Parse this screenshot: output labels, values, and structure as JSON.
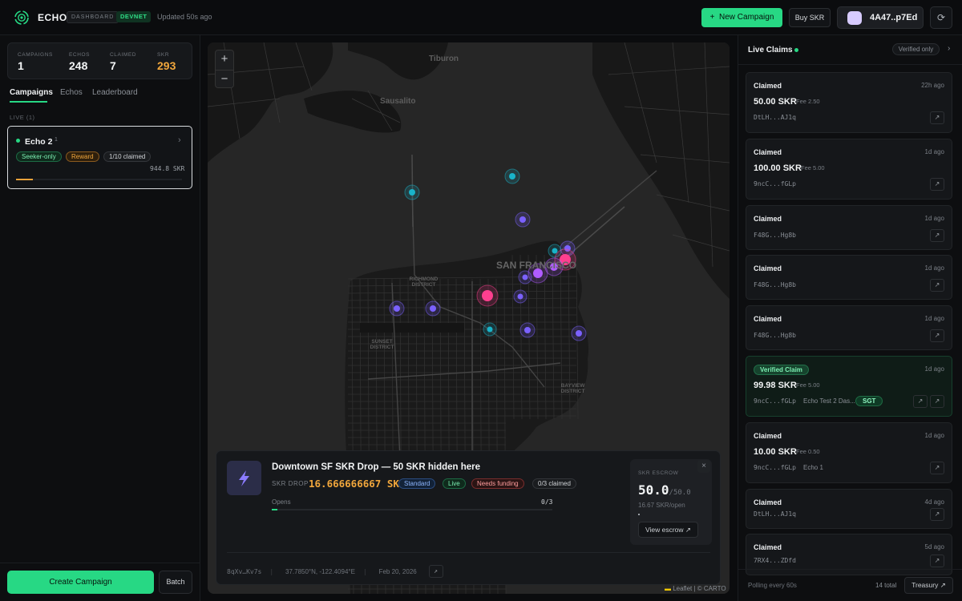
{
  "header": {
    "brand": "ECHO",
    "brand_sub": "DASHBOARD",
    "network": "DEVNET",
    "updated": "Updated 50s ago",
    "new_campaign": "New Campaign",
    "buy_skr": "Buy SKR",
    "wallet": "4A47..p7Ed",
    "accent": "#27d884"
  },
  "stats": [
    {
      "label": "CAMPAIGNS",
      "value": "1"
    },
    {
      "label": "ECHOS",
      "value": "248"
    },
    {
      "label": "CLAIMED",
      "value": "7"
    },
    {
      "label": "SKR",
      "value": "293",
      "color": "#f0a63c"
    }
  ],
  "tabs": [
    "Campaigns",
    "Echos",
    "Leaderboard"
  ],
  "live_header": "LIVE (1)",
  "campaign": {
    "name": "Echo 2",
    "index": "1",
    "tags": [
      "Seeker-only",
      "Reward",
      "1/10 claimed"
    ],
    "amount": "944.8 SKR",
    "progress": 0.1
  },
  "footer": {
    "create": "Create Campaign",
    "batch": "Batch"
  },
  "map": {
    "labels": [
      "Tiburon",
      "Sausalito",
      "SAN FRANCISCO",
      "RICHMOND DISTRICT",
      "SUNSET DISTRICT",
      "BAYVIEW DISTRICT"
    ],
    "attribution": "Leaflet | © CARTO",
    "zoom_in": "+",
    "zoom_out": "−"
  },
  "popup": {
    "title": "Downtown SF SKR Drop — 50 SKR hidden here",
    "kind": "SKR DROP",
    "amount": "16.666666667 SKR",
    "tags": [
      "Standard",
      "Live",
      "Needs funding",
      "0/3 claimed"
    ],
    "opens_label": "Opens",
    "opens_value": "0/3",
    "opens_progress": 0.02,
    "escrow_label": "SKR ESCROW",
    "escrow_value": "50.0",
    "escrow_total": "/50.0",
    "escrow_rate": "16.67 SKR/open",
    "escrow_dot": "·",
    "view_escrow": "View escrow",
    "address": "8qXv…Kv7s",
    "coords": "37.7850°N, -122.4094°E",
    "date": "Feb 20, 2026"
  },
  "live_claims": {
    "title": "Live Claims",
    "verified_only": "Verified only",
    "items": [
      {
        "type": "Claimed",
        "time": "22h ago",
        "amount": "50.00 SKR",
        "fee": "Fee 2.50",
        "addr": "DtLH...AJ1q",
        "extra": ""
      },
      {
        "type": "Claimed",
        "time": "1d ago",
        "amount": "100.00 SKR",
        "fee": "Fee 5.00",
        "addr": "9ncC...fGLp",
        "extra": ""
      },
      {
        "type": "Claimed",
        "time": "1d ago",
        "amount": "",
        "fee": "",
        "addr": "F48G...Hg8b",
        "extra": ""
      },
      {
        "type": "Claimed",
        "time": "1d ago",
        "amount": "",
        "fee": "",
        "addr": "F48G...Hg8b",
        "extra": ""
      },
      {
        "type": "Claimed",
        "time": "1d ago",
        "amount": "",
        "fee": "",
        "addr": "F48G...Hg8b",
        "extra": ""
      },
      {
        "type": "Verified Claim",
        "time": "1d ago",
        "amount": "99.98 SKR",
        "fee": "Fee 5.00",
        "addr": "9ncC...fGLp",
        "extra": "Echo Test 2 Das...",
        "badge": "SGT",
        "verified": true
      },
      {
        "type": "Claimed",
        "time": "1d ago",
        "amount": "10.00 SKR",
        "fee": "Fee 0.50",
        "addr": "9ncC...fGLp",
        "extra": "Echo 1"
      },
      {
        "type": "Claimed",
        "time": "4d ago",
        "amount": "",
        "fee": "",
        "addr": "DtLH...AJ1q",
        "extra": ""
      },
      {
        "type": "Claimed",
        "time": "5d ago",
        "amount": "",
        "fee": "",
        "addr": "7RX4...ZDfd",
        "extra": ""
      }
    ],
    "polling": "Polling every 60s",
    "total": "14 total",
    "treasury": "Treasury"
  }
}
